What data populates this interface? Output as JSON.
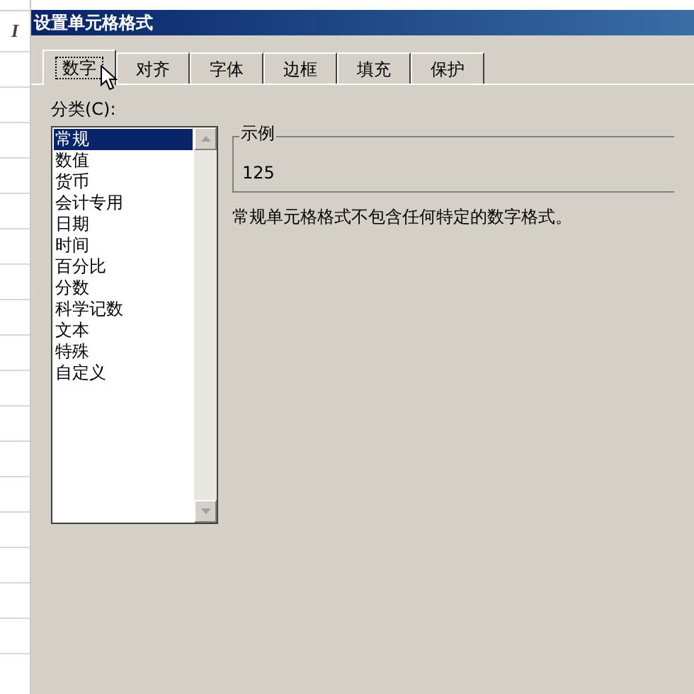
{
  "sheet": {
    "toolbar_glyph": "I"
  },
  "window": {
    "title": "设置单元格格式"
  },
  "tabs": [
    {
      "label": "数字",
      "selected": true
    },
    {
      "label": "对齐",
      "selected": false
    },
    {
      "label": "字体",
      "selected": false
    },
    {
      "label": "边框",
      "selected": false
    },
    {
      "label": "填充",
      "selected": false
    },
    {
      "label": "保护",
      "selected": false
    }
  ],
  "category": {
    "label": "分类(C):",
    "items": [
      {
        "label": "常规",
        "selected": true
      },
      {
        "label": "数值",
        "selected": false
      },
      {
        "label": "货币",
        "selected": false
      },
      {
        "label": "会计专用",
        "selected": false
      },
      {
        "label": "日期",
        "selected": false
      },
      {
        "label": "时间",
        "selected": false
      },
      {
        "label": "百分比",
        "selected": false
      },
      {
        "label": "分数",
        "selected": false
      },
      {
        "label": "科学记数",
        "selected": false
      },
      {
        "label": "文本",
        "selected": false
      },
      {
        "label": "特殊",
        "selected": false
      },
      {
        "label": "自定义",
        "selected": false
      }
    ]
  },
  "sample": {
    "label": "示例",
    "value": "125"
  },
  "description": "常规单元格格式不包含任何特定的数字格式。"
}
